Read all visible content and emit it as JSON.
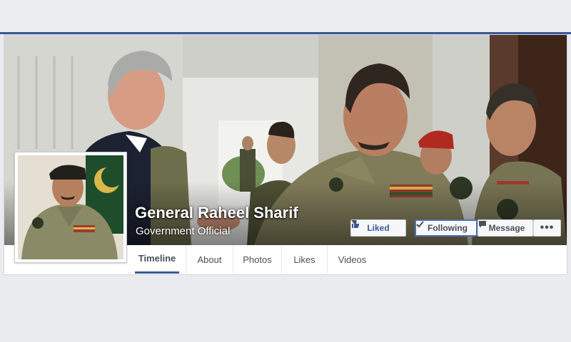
{
  "profile": {
    "name": "General Raheel Sharif",
    "category": "Government Official"
  },
  "actions": {
    "liked_label": "Liked",
    "following_label": "Following",
    "message_label": "Message",
    "more_label": "•••"
  },
  "tabs": [
    {
      "label": "Timeline",
      "active": true
    },
    {
      "label": "About",
      "active": false
    },
    {
      "label": "Photos",
      "active": false
    },
    {
      "label": "Likes",
      "active": false
    },
    {
      "label": "Videos",
      "active": false
    }
  ],
  "colors": {
    "brand": "#3b5998",
    "page_background": "#e9ebee"
  }
}
